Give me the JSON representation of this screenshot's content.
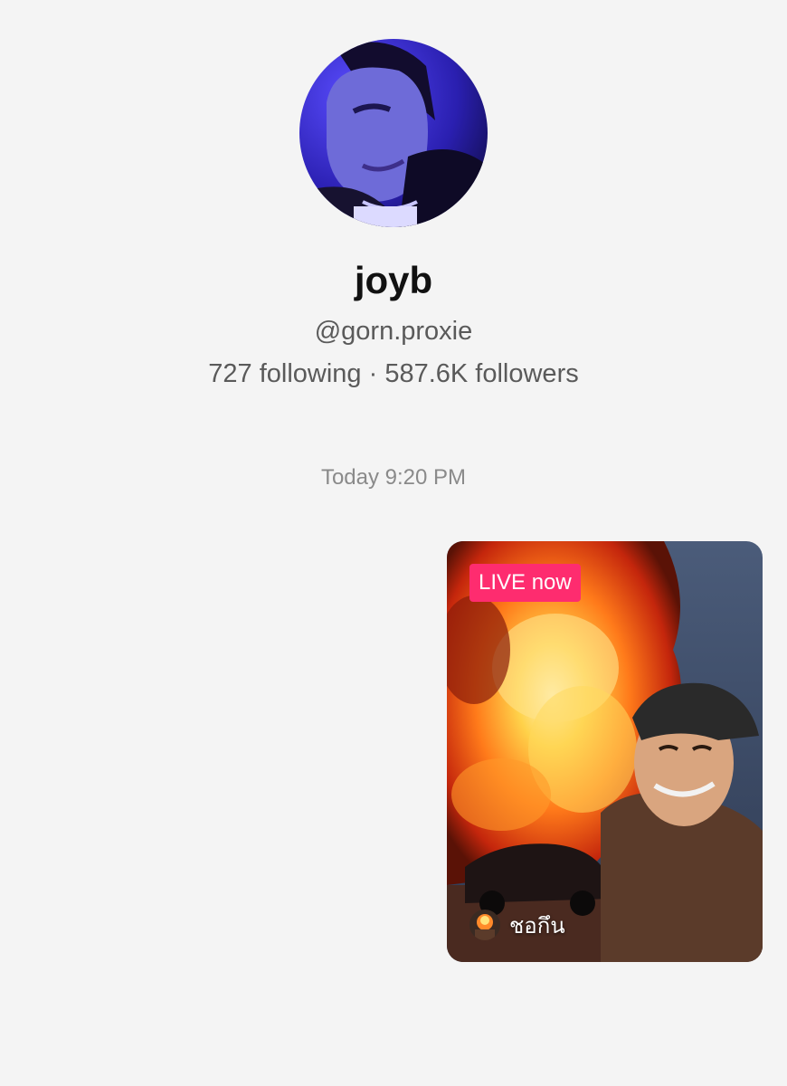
{
  "profile": {
    "avatar_icon": "profile-photo",
    "display_name": "joyb",
    "username": "@gorn.proxie",
    "stats": "727 following · 587.6K followers"
  },
  "chat": {
    "timestamp": "Today 9:20 PM"
  },
  "live_card": {
    "badge": "LIVE now",
    "badge_color": "#fe2c6f",
    "host_name": "ชอกึน",
    "thumbnail": "explosion-scene-with-host-video"
  }
}
